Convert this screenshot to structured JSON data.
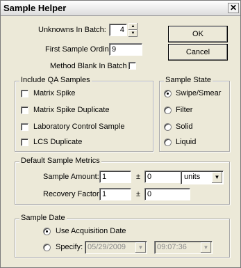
{
  "window": {
    "title": "Sample Helper",
    "close_glyph": "✕"
  },
  "batch": {
    "unknowns_label": "Unknowns In Batch:",
    "unknowns_value": "4",
    "first_ordinal_label": "First Sample Ordinal:",
    "first_ordinal_value": "9",
    "method_blank_label": "Method Blank In Batch",
    "method_blank_checked": false
  },
  "buttons": {
    "ok": "OK",
    "cancel": "Cancel"
  },
  "qa": {
    "title": "Include QA Samples",
    "items": [
      {
        "label": "Matrix Spike",
        "checked": false
      },
      {
        "label": "Matrix Spike Duplicate",
        "checked": false
      },
      {
        "label": "Laboratory Control Sample",
        "checked": false
      },
      {
        "label": "LCS Duplicate",
        "checked": false
      }
    ]
  },
  "state": {
    "title": "Sample State",
    "options": [
      {
        "label": "Swipe/Smear",
        "selected": true
      },
      {
        "label": "Filter",
        "selected": false
      },
      {
        "label": "Solid",
        "selected": false
      },
      {
        "label": "Liquid",
        "selected": false
      }
    ]
  },
  "metrics": {
    "title": "Default Sample Metrics",
    "amount_label": "Sample Amount:",
    "amount_value": "1",
    "amount_pm": "±",
    "amount_unc": "0",
    "units_value": "units",
    "recovery_label": "Recovery Factor:",
    "recovery_value": "1",
    "recovery_pm": "±",
    "recovery_unc": "0"
  },
  "date": {
    "title": "Sample Date",
    "use_acq_label": "Use Acquisition Date",
    "use_acq_selected": true,
    "specify_label": "Specify:",
    "specify_selected": false,
    "date_value": "05/29/2009",
    "time_value": "09:07:36"
  },
  "icons": {
    "spin_up": "▲",
    "spin_down": "▼",
    "dropdown": "▼"
  }
}
